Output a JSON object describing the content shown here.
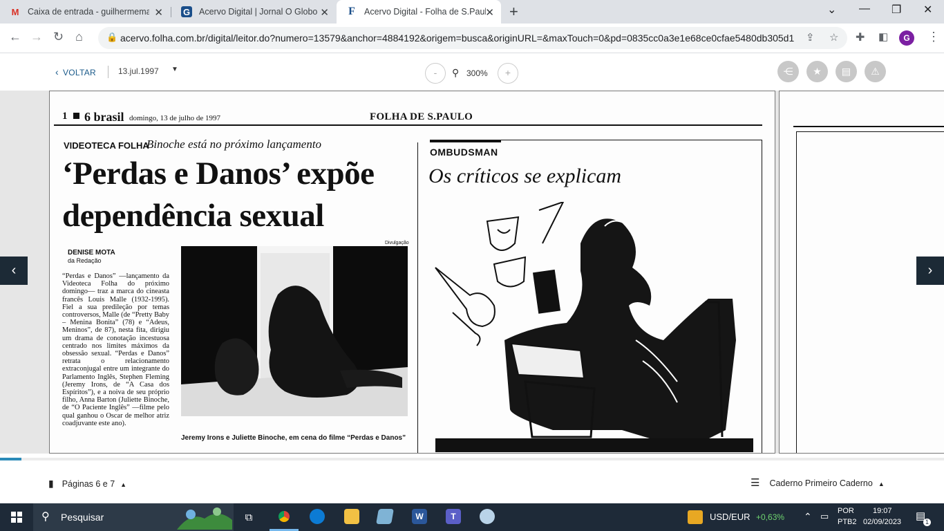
{
  "browser": {
    "tabs": [
      {
        "title": "Caixa de entrada - guilhermemaz",
        "favicon": "M",
        "favicon_color": "#d93025"
      },
      {
        "title": "Acervo Digital | Jornal O Globo",
        "favicon": "G",
        "favicon_color": "#1a4e8a"
      },
      {
        "title": "Acervo Digital - Folha de S.Paulo",
        "favicon": "F",
        "favicon_color": "#1b4f8a"
      }
    ],
    "active_tab": 2,
    "url": "acervo.folha.com.br/digital/leitor.do?numero=13579&anchor=4884192&origem=busca&originURL=&maxTouch=0&pd=0835cc0a3e1e68ce0cfae5480db305d1",
    "profile_initial": "G"
  },
  "reader": {
    "back_label": "VOLTAR",
    "date": "13.jul.1997",
    "zoom": "300%",
    "zoom_minus": "-",
    "zoom_plus": "+",
    "progress_fraction": 0.023
  },
  "newspaper": {
    "page_num": "1",
    "section": "6 brasil",
    "dateline": "domingo, 13 de julho de 1997",
    "masthead": "FOLHA DE S.PAULO",
    "kicker": "VIDEOTECA FOLHA",
    "kicker_sub": "Binoche está no próximo lançamento",
    "headline_1": "‘Perdas e Danos’ expõe",
    "headline_2": "dependência sexual",
    "byline": "DENISE MOTA",
    "byline_sub": "da Redação",
    "photo_credit": "Divulgação",
    "caption": "Jeremy Irons e Juliette Binoche, em cena do filme “Perdas e Danos”",
    "body": "“Perdas e Danos” —lançamento da Videoteca Folha do próximo domingo— traz a marca do cineasta francês Louis Malle (1932-1995). Fiel a sua predileção por temas controversos, Malle (de “Pretty Baby – Menina Bonita” (78) e “Adeus, Meninos”, de 87), nesta fita, dirigiu um drama de conotação incestuosa centrado nos limites máximos da obsessão sexual. “Perdas e Danos” retrata o relacionamento extraconjugal entre um integrante do Parlamento Inglês, Stephen Fleming (Jeremy Irons, de “A Casa dos Espíritos”), e a noiva de seu próprio filho, Anna Barton (Juliette Binoche, de “O Paciente Inglês” —filme pelo qual ganhou o Oscar de melhor atriz coadjuvante este ano).",
    "ombudsman_label": "OMBUDSMAN",
    "ombudsman_title": "Os críticos se explicam"
  },
  "footer": {
    "pages_label": "Páginas 6 e 7",
    "section_label": "Caderno Primeiro Caderno"
  },
  "taskbar": {
    "search_placeholder": "Pesquisar",
    "ticker_name": "USD/EUR",
    "ticker_change": "+0,63%",
    "lang_1": "POR",
    "lang_2": "PTB2",
    "time": "19:07",
    "date": "02/09/2023",
    "notif_count": "1"
  }
}
